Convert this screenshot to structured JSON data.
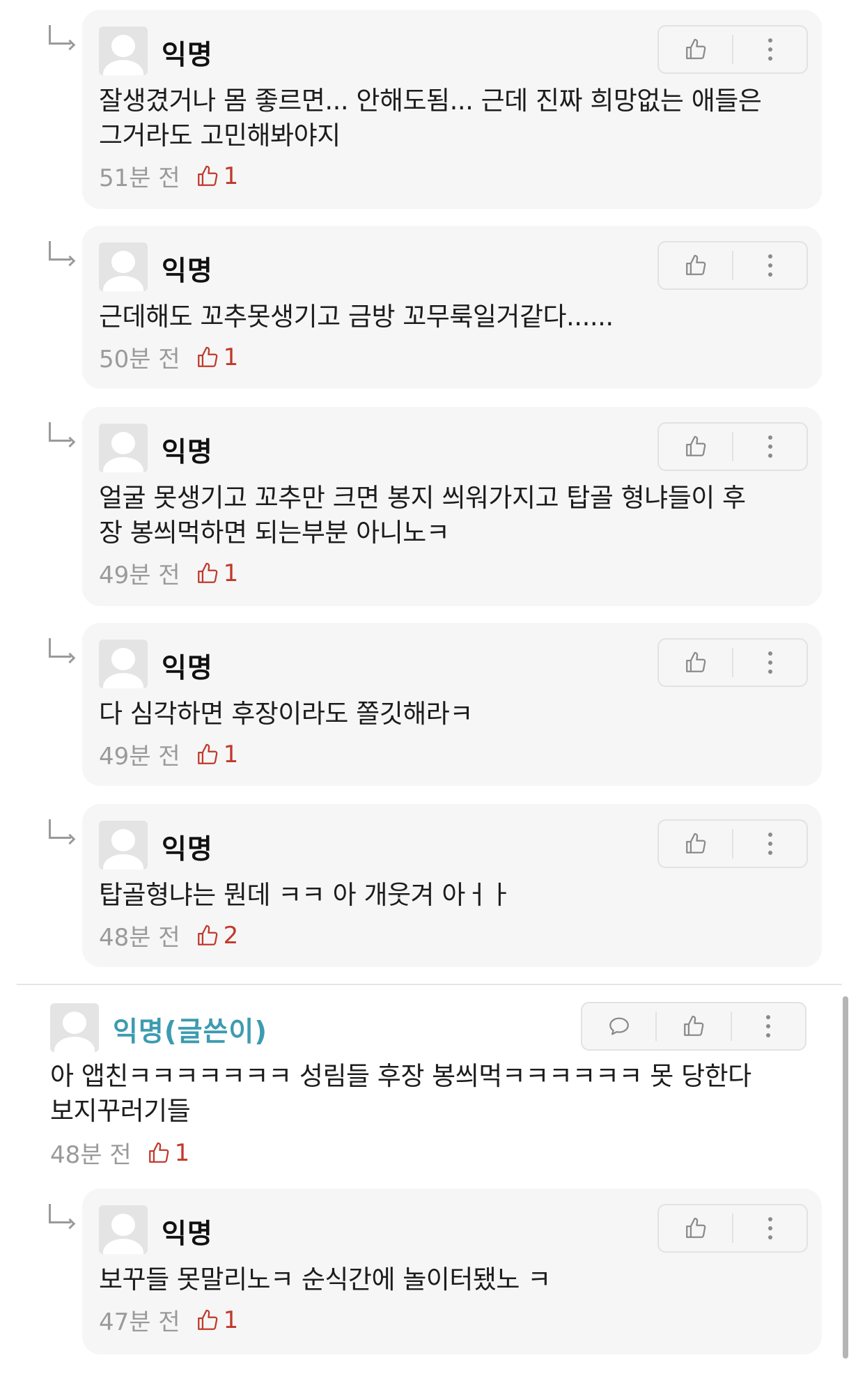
{
  "comments": [
    {
      "author": "익명",
      "lines": [
        "잘생겼거나 몸 좋르면... 안해도됨... 근데 진짜 희망없는 애들은",
        "그거라도 고민해봐야지"
      ],
      "time": "51분 전",
      "likes": "1"
    },
    {
      "author": "익명",
      "lines": [
        "근데해도 꼬추못생기고 금방 꼬무룩일거같다......"
      ],
      "time": "50분 전",
      "likes": "1"
    },
    {
      "author": "익명",
      "lines": [
        "얼굴 못생기고 꼬추만 크면 봉지 씌워가지고 탑골 형냐들이 후",
        "장 봉씌먹하면 되는부분 아니노ㅋ"
      ],
      "time": "49분 전",
      "likes": "1"
    },
    {
      "author": "익명",
      "lines": [
        "다 심각하면 후장이라도 쫄깃해라ㅋ"
      ],
      "time": "49분 전",
      "likes": "1"
    },
    {
      "author": "익명",
      "lines": [
        "탑골형냐는 뭔데 ㅋㅋ 아 개웃겨 아ㅓㅏ"
      ],
      "time": "48분 전",
      "likes": "2"
    },
    {
      "author": "익명(글쓴이)",
      "lines": [
        "아 앱친ㅋㅋㅋㅋㅋㅋㅋ 성림들 후장 봉씌먹ㅋㅋㅋㅋㅋㅋ 못 당한다",
        "보지꾸러기들"
      ],
      "time": "48분 전",
      "likes": "1"
    },
    {
      "author": "익명",
      "lines": [
        "보꾸들 못말리노ㅋ 순식간에 놀이터됐노 ㅋ"
      ],
      "time": "47분 전",
      "likes": "1"
    }
  ],
  "icons": {
    "reply_arrow": "reply-arrow-icon",
    "like": "thumbs-up-icon",
    "more": "more-vertical-icon",
    "comment": "comment-bubble-icon",
    "avatar": "default-avatar-icon"
  },
  "colors": {
    "like_count": "#c0392b",
    "author_name": "#3d9bb0",
    "meta_text": "#9a9a9a",
    "reply_bg": "#f6f6f6"
  }
}
